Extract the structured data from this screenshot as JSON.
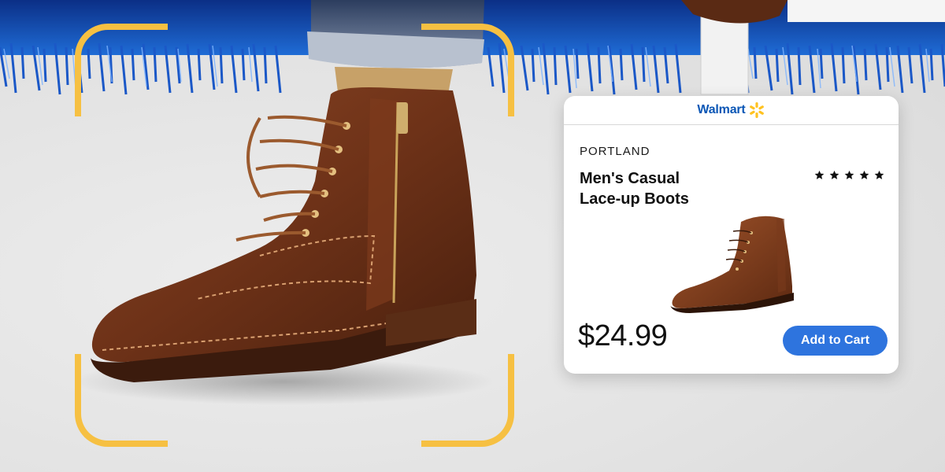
{
  "card": {
    "store_name": "Walmart",
    "store_logo_icon": "walmart-spark-icon",
    "brand": "PORTLAND",
    "title_line1": "Men's Casual",
    "title_line2": "Lace-up Boots",
    "rating": 5,
    "rating_max": 5,
    "price": "$24.99",
    "add_to_cart_label": "Add to Cart"
  },
  "colors": {
    "scan_frame": "#f6c042",
    "brand_blue": "#0a56b5",
    "spark_yellow": "#ffc220",
    "button_blue": "#2e74de",
    "boot_brown": "#7a3a1c"
  },
  "icons": [
    "walmart-spark-icon",
    "star-icon",
    "boot-photo"
  ]
}
